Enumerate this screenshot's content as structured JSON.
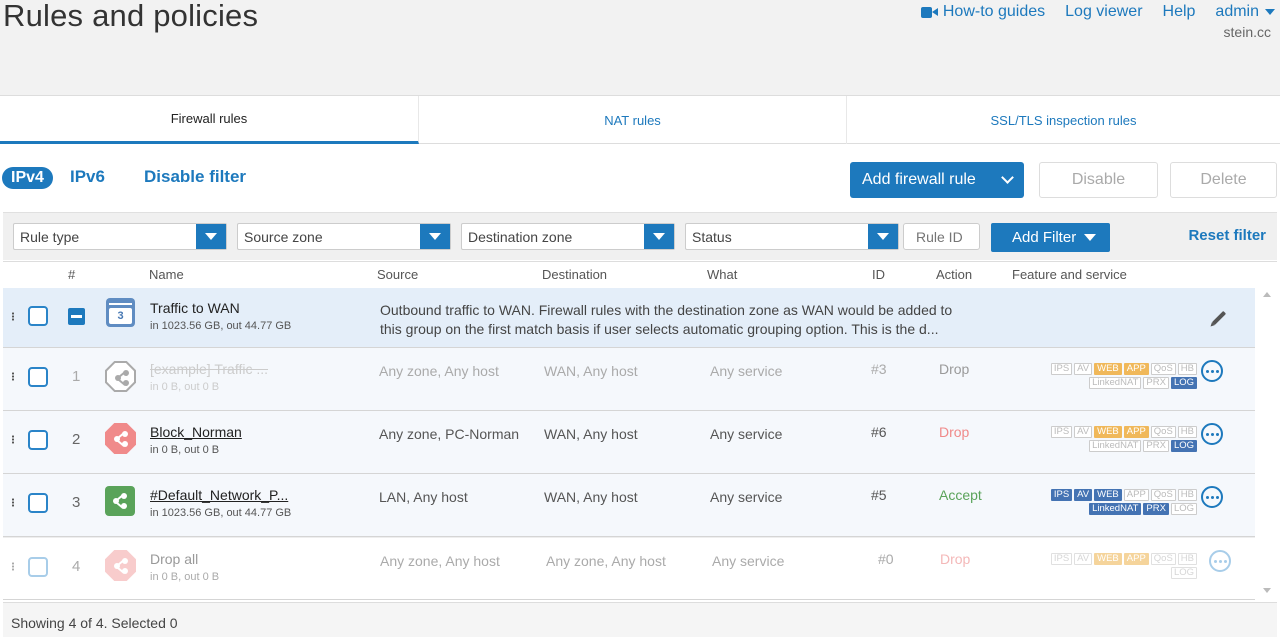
{
  "header": {
    "title": "Rules and policies",
    "links": {
      "howto": "How-to guides",
      "logviewer": "Log viewer",
      "help": "Help",
      "admin": "admin"
    },
    "domain": "stein.cc"
  },
  "tabs": [
    {
      "label": "Firewall rules",
      "active": true
    },
    {
      "label": "NAT rules",
      "active": false
    },
    {
      "label": "SSL/TLS inspection rules",
      "active": false
    }
  ],
  "toolbar": {
    "ipv4": "IPv4",
    "ipv6": "IPv6",
    "disable_filter": "Disable filter",
    "add_rule": "Add firewall rule",
    "disable": "Disable",
    "delete": "Delete"
  },
  "filters": {
    "rule_type": "Rule type",
    "source_zone": "Source zone",
    "destination_zone": "Destination zone",
    "status": "Status",
    "rule_id_placeholder": "Rule ID",
    "add_filter": "Add Filter",
    "reset_filter": "Reset filter"
  },
  "columns": [
    "#",
    "Name",
    "Source",
    "Destination",
    "What",
    "ID",
    "Action",
    "Feature and service"
  ],
  "group": {
    "count": "3",
    "name": "Traffic to WAN",
    "traffic": "in 1023.56 GB, out 44.77 GB",
    "description_line1": "Outbound traffic to WAN. Firewall rules with the destination zone as WAN would be added to",
    "description_line2": "this group on the first match basis if user selects automatic grouping option. This is the d..."
  },
  "rules": [
    {
      "num": "1",
      "name": "[example] Traffic ...",
      "traffic": "in 0 B, out 0 B",
      "source": "Any zone, Any host",
      "destination": "WAN, Any host",
      "what": "Any service",
      "id": "#3",
      "action": "Drop",
      "action_color": "#9a9a9a"
    },
    {
      "num": "2",
      "name": "Block_Norman",
      "traffic": "in 0 B, out 0 B",
      "source": "Any zone, PC-Norman",
      "destination": "WAN, Any host",
      "what": "Any service",
      "id": "#6",
      "action": "Drop",
      "action_color": "#f08a8a"
    },
    {
      "num": "3",
      "name": "#Default_Network_P...",
      "traffic": "in 1023.56 GB, out 44.77 GB",
      "source": "LAN, Any host",
      "destination": "WAN, Any host",
      "what": "Any service",
      "id": "#5",
      "action": "Accept",
      "action_color": "#5aa35a"
    },
    {
      "num": "4",
      "name": "Drop all",
      "traffic": "in 0 B, out 0 B",
      "source": "Any zone, Any host",
      "destination": "Any zone, Any host",
      "what": "Any service",
      "id": "#0",
      "action": "Drop",
      "action_color": "#f4b8b8"
    }
  ],
  "badges": {
    "line1": [
      "IPS",
      "AV",
      "WEB",
      "APP",
      "QoS",
      "HB"
    ],
    "line2": [
      "LinkedNAT",
      "PRX",
      "LOG"
    ]
  },
  "status_text": "Showing 4 of 4. Selected 0",
  "colors": {
    "accent": "#1d79bd",
    "group_bg": "#e4eef9",
    "accept": "#5aa35a",
    "drop": "#f08a8a"
  }
}
